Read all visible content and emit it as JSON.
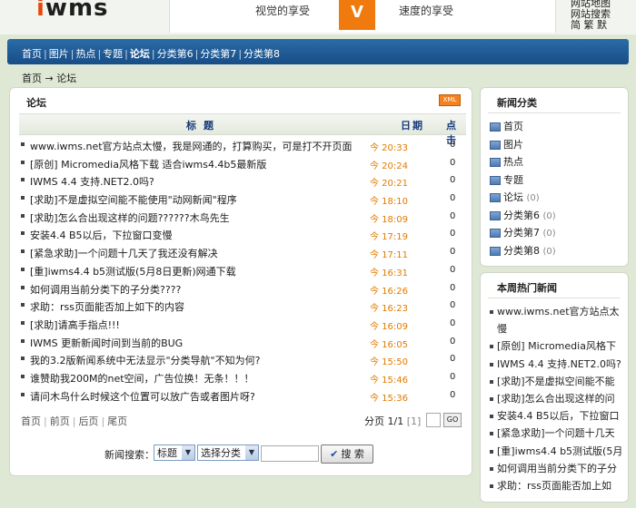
{
  "header": {
    "logo_i": "i",
    "logo_rest": "wms",
    "banner_left": "视觉的享受",
    "banner_mark": "V",
    "banner_right": "速度的享受",
    "links": [
      "网站地图",
      "网站搜索",
      "简 繁 默"
    ]
  },
  "nav": {
    "items": [
      {
        "label": "首页"
      },
      {
        "label": "图片"
      },
      {
        "label": "热点"
      },
      {
        "label": "专题"
      },
      {
        "label": "论坛",
        "current": true
      },
      {
        "label": "分类第6"
      },
      {
        "label": "分类第7"
      },
      {
        "label": "分类第8"
      }
    ]
  },
  "breadcrumb": {
    "home": "首页",
    "arrow": "→",
    "current": "论坛"
  },
  "main": {
    "title": "论坛",
    "xml_label": "XML",
    "columns": {
      "title": "标题",
      "date": "日期",
      "clicks": "点击"
    },
    "rows": [
      {
        "title": "www.iwms.net官方站点太慢，我是网通的，打算购买，可是打不开页面",
        "date": "今 20:33",
        "clicks": "0"
      },
      {
        "title": "[原创] Micromedia风格下载 适合iwms4.4b5最新版",
        "date": "今 20:24",
        "clicks": "0"
      },
      {
        "title": "IWMS 4.4 支持.NET2.0吗?",
        "date": "今 20:21",
        "clicks": "0"
      },
      {
        "title": "[求助]不是虚拟空间能不能使用\"动网新闻\"程序",
        "date": "今 18:10",
        "clicks": "0"
      },
      {
        "title": "[求助]怎么合出现这样的问题??????木鸟先生",
        "date": "今 18:09",
        "clicks": "0"
      },
      {
        "title": "安装4.4 B5以后，下拉窗口变慢",
        "date": "今 17:19",
        "clicks": "0"
      },
      {
        "title": "[紧急求助]一个问题十几天了我还没有解决",
        "date": "今 17:11",
        "clicks": "0"
      },
      {
        "title": "[重]iwms4.4 b5测试版(5月8日更新)网通下载",
        "date": "今 16:31",
        "clicks": "0"
      },
      {
        "title": "如何调用当前分类下的子分类????",
        "date": "今 16:26",
        "clicks": "0"
      },
      {
        "title": "求助：rss页面能否加上如下的内容",
        "date": "今 16:23",
        "clicks": "0"
      },
      {
        "title": "[求助]请高手指点!!!",
        "date": "今 16:09",
        "clicks": "0"
      },
      {
        "title": "IWMS 更新新闻时间到当前的BUG",
        "date": "今 16:05",
        "clicks": "0"
      },
      {
        "title": "我的3.2版新闻系统中无法显示\"分类导航\"不知为何?",
        "date": "今 15:50",
        "clicks": "0"
      },
      {
        "title": "谁赞助我200M的net空间，广告位换！无条！！！",
        "date": "今 15:46",
        "clicks": "0"
      },
      {
        "title": "请问木鸟什么时候这个位置可以放广告或者图片呀?",
        "date": "今 15:36",
        "clicks": "0"
      }
    ],
    "pager": {
      "first": "首页",
      "prev": "前页",
      "next": "后页",
      "last": "尾页",
      "info_prefix": "分页 1/1",
      "bracket": "[1]",
      "go": "GO"
    },
    "search": {
      "label": "新闻搜索：",
      "field_select": "标题",
      "category_select": "选择分类",
      "button": "搜 索"
    }
  },
  "side_categories": {
    "title": "新闻分类",
    "items": [
      {
        "label": "首页",
        "count": ""
      },
      {
        "label": "图片",
        "count": ""
      },
      {
        "label": "热点",
        "count": ""
      },
      {
        "label": "专题",
        "count": ""
      },
      {
        "label": "论坛",
        "count": "(0)"
      },
      {
        "label": "分类第6",
        "count": "(0)"
      },
      {
        "label": "分类第7",
        "count": "(0)"
      },
      {
        "label": "分类第8",
        "count": "(0)"
      }
    ]
  },
  "side_hot": {
    "title": "本周热门新闻",
    "items": [
      {
        "label": "www.iwms.net官方站点太"
      },
      {
        "label": "慢"
      },
      {
        "label": "[原创] Micromedia风格下"
      },
      {
        "label": "IWMS 4.4 支持.NET2.0吗?"
      },
      {
        "label": "[求助]不是虚拟空间能不能"
      },
      {
        "label": "[求助]怎么合出现这样的问"
      },
      {
        "label": "安装4.4 B5以后，下拉窗口"
      },
      {
        "label": "[紧急求助]一个问题十几天"
      },
      {
        "label": "[重]iwms4.4 b5测试版(5月"
      },
      {
        "label": "如何调用当前分类下的子分"
      },
      {
        "label": "求助：rss页面能否加上如"
      }
    ]
  }
}
